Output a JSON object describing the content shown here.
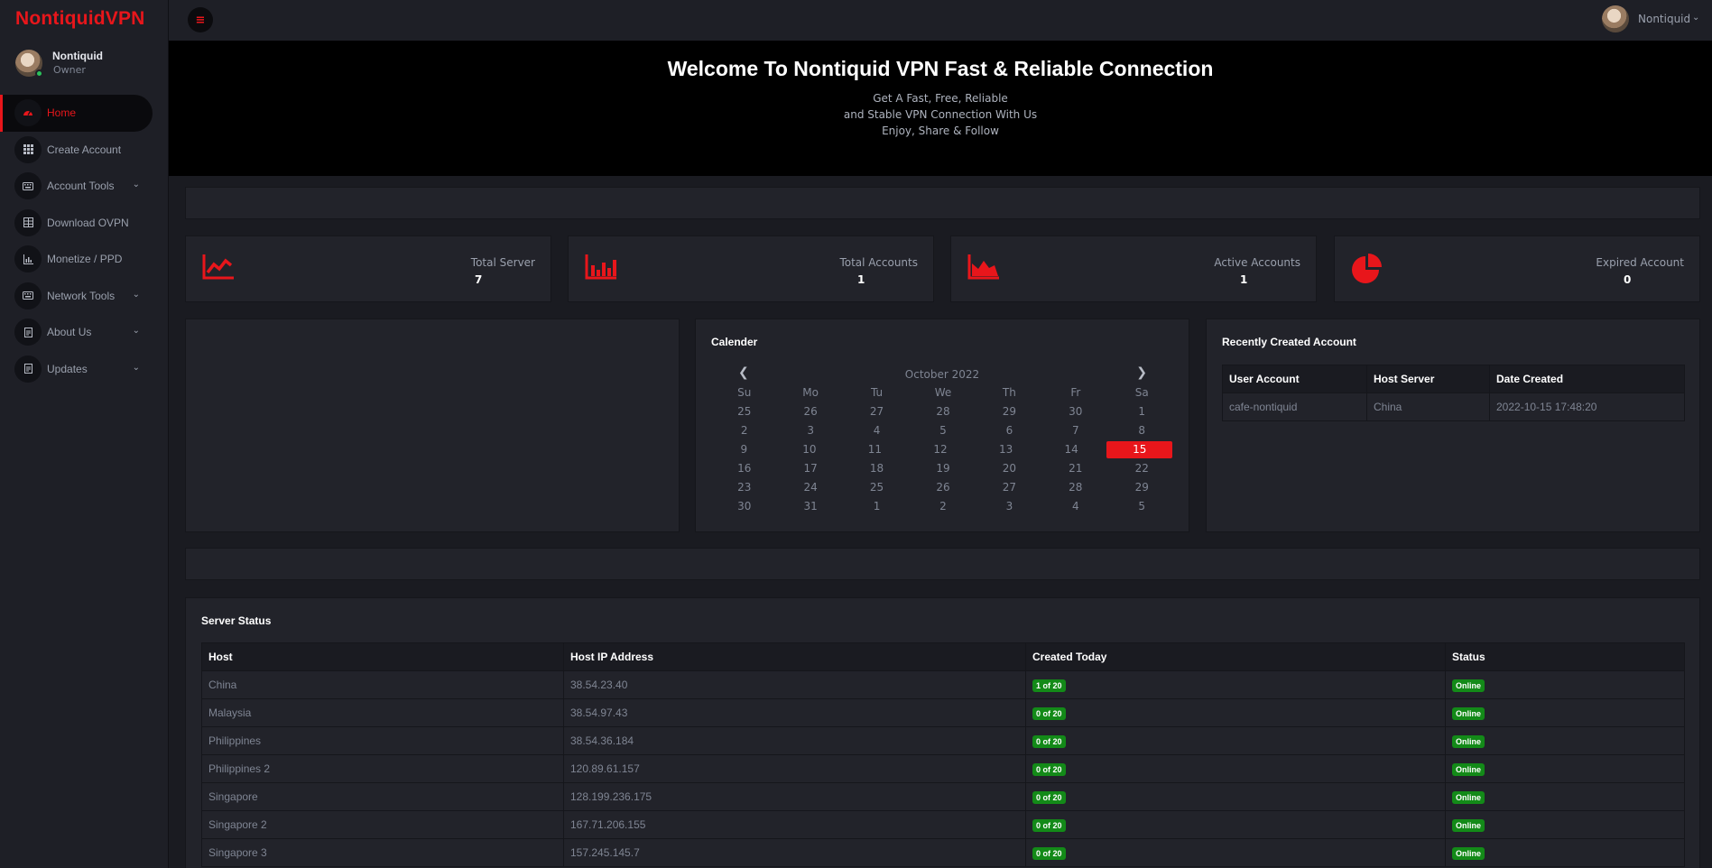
{
  "brand": "NontiquidVPN",
  "profile": {
    "name": "Nontiquid",
    "role": "Owner"
  },
  "nav": [
    {
      "label": "Home",
      "icon": "dashboard-icon"
    },
    {
      "label": "Create Account",
      "icon": "grid-icon"
    },
    {
      "label": "Account Tools",
      "icon": "keyboard-icon"
    },
    {
      "label": "Download OVPN",
      "icon": "table-icon"
    },
    {
      "label": "Monetize / PPD",
      "icon": "chart-icon"
    },
    {
      "label": "Network Tools",
      "icon": "keyboard-icon"
    },
    {
      "label": "About Us",
      "icon": "document-icon"
    },
    {
      "label": "Updates",
      "icon": "document-icon"
    }
  ],
  "topbar": {
    "user_name": "Nontiquid"
  },
  "hero": {
    "title": "Welcome To Nontiquid VPN Fast & Reliable Connection",
    "line1": "Get A Fast, Free, Reliable",
    "line2": "and Stable VPN Connection With Us",
    "line3": "Enjoy, Share & Follow"
  },
  "stats": [
    {
      "label": "Total Server",
      "value": "7",
      "icon": "line-chart-icon"
    },
    {
      "label": "Total Accounts",
      "value": "1",
      "icon": "bar-chart-icon"
    },
    {
      "label": "Active Accounts",
      "value": "1",
      "icon": "area-chart-icon"
    },
    {
      "label": "Expired Account",
      "value": "0",
      "icon": "pie-chart-icon"
    }
  ],
  "calendar": {
    "title": "Calender",
    "month": "October 2022",
    "days": [
      "Su",
      "Mo",
      "Tu",
      "We",
      "Th",
      "Fr",
      "Sa"
    ],
    "weeks": [
      [
        "25",
        "26",
        "27",
        "28",
        "29",
        "30",
        "1"
      ],
      [
        "2",
        "3",
        "4",
        "5",
        "6",
        "7",
        "8"
      ],
      [
        "9",
        "10",
        "11",
        "12",
        "13",
        "14",
        "15"
      ],
      [
        "16",
        "17",
        "18",
        "19",
        "20",
        "21",
        "22"
      ],
      [
        "23",
        "24",
        "25",
        "26",
        "27",
        "28",
        "29"
      ],
      [
        "30",
        "31",
        "1",
        "2",
        "3",
        "4",
        "5"
      ]
    ],
    "today": "15"
  },
  "recent": {
    "title": "Recently Created Account",
    "headers": [
      "User Account",
      "Host Server",
      "Date Created"
    ],
    "rows": [
      [
        "cafe-nontiquid",
        "China",
        "2022-10-15 17:48:20"
      ]
    ]
  },
  "server_status": {
    "title": "Server Status",
    "headers": [
      "Host",
      "Host IP Address",
      "Created Today",
      "Status"
    ],
    "rows": [
      [
        "China",
        "38.54.23.40",
        "1 of 20",
        "Online"
      ],
      [
        "Malaysia",
        "38.54.97.43",
        "0 of 20",
        "Online"
      ],
      [
        "Philippines",
        "38.54.36.184",
        "0 of 20",
        "Online"
      ],
      [
        "Philippines 2",
        "120.89.61.157",
        "0 of 20",
        "Online"
      ],
      [
        "Singapore",
        "128.199.236.175",
        "0 of 20",
        "Online"
      ],
      [
        "Singapore 2",
        "167.71.206.155",
        "0 of 20",
        "Online"
      ],
      [
        "Singapore 3",
        "157.245.145.7",
        "0 of 20",
        "Online"
      ]
    ]
  },
  "colors": {
    "accent": "#e8161b",
    "online": "#138a18",
    "bg": "#1a1b21",
    "panel": "#22232a"
  }
}
